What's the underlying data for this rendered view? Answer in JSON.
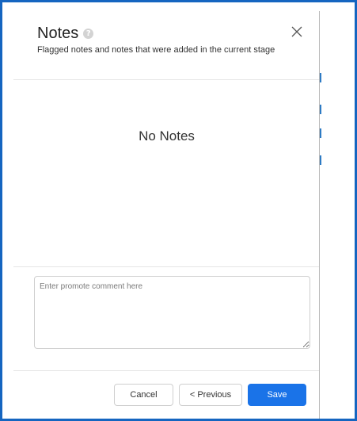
{
  "dialog": {
    "title": "Notes",
    "help_icon": "question-icon",
    "subtitle": "Flagged notes and notes that were added in the current stage",
    "close_icon": "close-icon"
  },
  "notes": {
    "empty_message": "No Notes"
  },
  "comment": {
    "placeholder": "Enter promote comment here",
    "value": ""
  },
  "footer": {
    "cancel_label": "Cancel",
    "previous_label": "< Previous",
    "save_label": "Save"
  },
  "colors": {
    "frame_border": "#1565c0",
    "primary": "#1a73e8"
  }
}
